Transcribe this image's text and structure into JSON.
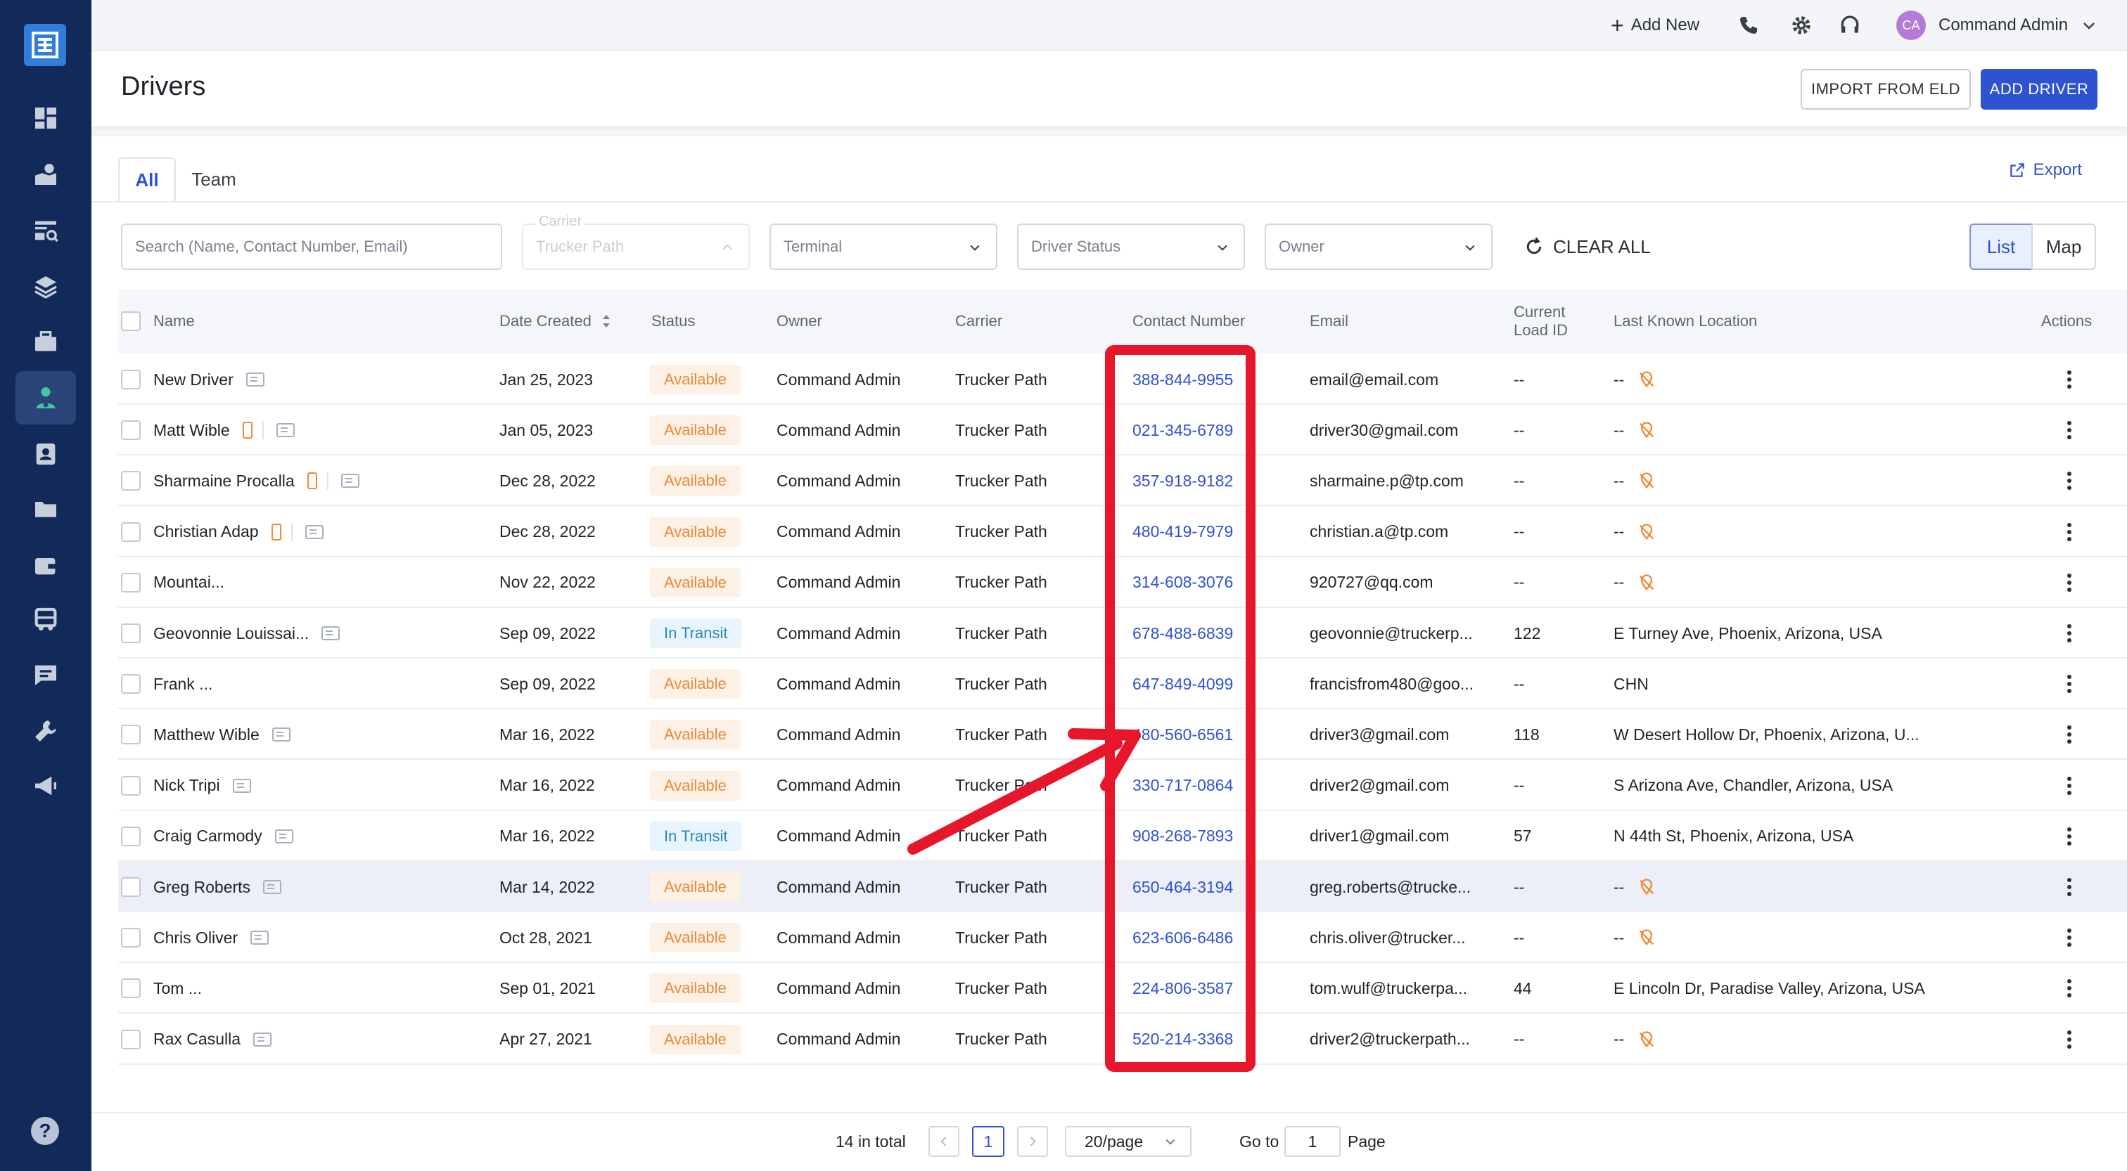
{
  "sidebar": {
    "items": [
      {
        "icon": "dashboard-icon"
      },
      {
        "icon": "tracking-icon"
      },
      {
        "icon": "loadboard-icon"
      },
      {
        "icon": "layers-icon"
      },
      {
        "icon": "briefcase-icon"
      },
      {
        "icon": "drivers-icon",
        "active": true
      },
      {
        "icon": "contacts-icon"
      },
      {
        "icon": "folder-icon"
      },
      {
        "icon": "wallet-icon"
      },
      {
        "icon": "truck-icon"
      },
      {
        "icon": "message-icon"
      },
      {
        "icon": "tools-icon"
      },
      {
        "icon": "megaphone-icon"
      }
    ],
    "help_label": "?"
  },
  "topbar": {
    "add_new": "Add New",
    "avatar_initials": "CA",
    "user_name": "Command Admin"
  },
  "header": {
    "title": "Drivers",
    "import_label": "IMPORT FROM ELD",
    "add_label": "ADD DRIVER"
  },
  "tabs": [
    {
      "label": "All"
    },
    {
      "label": "Team"
    }
  ],
  "export_label": "Export",
  "filters": {
    "search_placeholder": "Search (Name, Contact Number, Email)",
    "carrier_label": "Carrier",
    "carrier_value": "Trucker Path",
    "terminal": "Terminal",
    "driver_status": "Driver Status",
    "owner": "Owner",
    "clear_all": "CLEAR ALL",
    "view_list": "List",
    "view_map": "Map"
  },
  "columns": {
    "name": "Name",
    "date_created": "Date Created",
    "status": "Status",
    "owner": "Owner",
    "carrier": "Carrier",
    "contact": "Contact Number",
    "email": "Email",
    "load_line1": "Current",
    "load_line2": "Load ID",
    "location": "Last Known Location",
    "actions": "Actions"
  },
  "colors": {
    "available_bg": "#fdf0e4",
    "available_fg": "#ea8a3b",
    "transit_bg": "#e7f4fb",
    "transit_fg": "#2f86b8",
    "annotation": "#e8162b"
  },
  "rows": [
    {
      "name": "New Driver",
      "phone_icon": false,
      "date": "Jan 25, 2023",
      "status": "Available",
      "owner": "Command Admin",
      "carrier": "Trucker Path",
      "contact": "388-844-9955",
      "email": "email@email.com",
      "load": "--",
      "location": "--",
      "no_loc_icon": true
    },
    {
      "name": "Matt Wible",
      "phone_icon": true,
      "date": "Jan 05, 2023",
      "status": "Available",
      "owner": "Command Admin",
      "carrier": "Trucker Path",
      "contact": "021-345-6789",
      "email": "driver30@gmail.com",
      "load": "--",
      "location": "--",
      "no_loc_icon": true
    },
    {
      "name": "Sharmaine Procalla",
      "phone_icon": true,
      "date": "Dec 28, 2022",
      "status": "Available",
      "owner": "Command Admin",
      "carrier": "Trucker Path",
      "contact": "357-918-9182",
      "email": "sharmaine.p@tp.com",
      "load": "--",
      "location": "--",
      "no_loc_icon": true
    },
    {
      "name": "Christian Adap",
      "phone_icon": true,
      "date": "Dec 28, 2022",
      "status": "Available",
      "owner": "Command Admin",
      "carrier": "Trucker Path",
      "contact": "480-419-7979",
      "email": "christian.a@tp.com",
      "load": "--",
      "location": "--",
      "no_loc_icon": true
    },
    {
      "name": "Mountai...",
      "phone_icon": false,
      "no_card": true,
      "date": "Nov 22, 2022",
      "status": "Available",
      "owner": "Command Admin",
      "carrier": "Trucker Path",
      "contact": "314-608-3076",
      "email": "920727@qq.com",
      "load": "--",
      "location": "--",
      "no_loc_icon": true
    },
    {
      "name": "Geovonnie Louissai...",
      "phone_icon": false,
      "date": "Sep 09, 2022",
      "status": "In Transit",
      "owner": "Command Admin",
      "carrier": "Trucker Path",
      "contact": "678-488-6839",
      "email": "geovonnie@truckerp...",
      "load": "122",
      "location": "E Turney Ave, Phoenix, Arizona, USA",
      "no_loc_icon": false
    },
    {
      "name": "Frank ...",
      "phone_icon": false,
      "no_card": true,
      "date": "Sep 09, 2022",
      "status": "Available",
      "owner": "Command Admin",
      "carrier": "Trucker Path",
      "contact": "647-849-4099",
      "email": "francisfrom480@goo...",
      "load": "--",
      "location": "CHN",
      "no_loc_icon": false
    },
    {
      "name": "Matthew Wible",
      "phone_icon": false,
      "date": "Mar 16, 2022",
      "status": "Available",
      "owner": "Command Admin",
      "carrier": "Trucker Path",
      "contact": "480-560-6561",
      "email": "driver3@gmail.com",
      "load": "118",
      "location": "W Desert Hollow Dr, Phoenix, Arizona, U...",
      "no_loc_icon": false
    },
    {
      "name": "Nick Tripi",
      "phone_icon": false,
      "date": "Mar 16, 2022",
      "status": "Available",
      "owner": "Command Admin",
      "carrier": "Trucker Path",
      "contact": "330-717-0864",
      "email": "driver2@gmail.com",
      "load": "--",
      "location": "S Arizona Ave, Chandler, Arizona, USA",
      "no_loc_icon": false
    },
    {
      "name": "Craig Carmody",
      "phone_icon": false,
      "date": "Mar 16, 2022",
      "status": "In Transit",
      "owner": "Command Admin",
      "carrier": "Trucker Path",
      "contact": "908-268-7893",
      "email": "driver1@gmail.com",
      "load": "57",
      "location": "N 44th St, Phoenix, Arizona, USA",
      "no_loc_icon": false
    },
    {
      "name": "Greg Roberts",
      "phone_icon": false,
      "date": "Mar 14, 2022",
      "status": "Available",
      "owner": "Command Admin",
      "carrier": "Trucker Path",
      "contact": "650-464-3194",
      "email": "greg.roberts@trucke...",
      "load": "--",
      "location": "--",
      "no_loc_icon": true,
      "highlight": true
    },
    {
      "name": "Chris Oliver",
      "phone_icon": false,
      "date": "Oct 28, 2021",
      "status": "Available",
      "owner": "Command Admin",
      "carrier": "Trucker Path",
      "contact": "623-606-6486",
      "email": "chris.oliver@trucker...",
      "load": "--",
      "location": "--",
      "no_loc_icon": true
    },
    {
      "name": "Tom ...",
      "phone_icon": false,
      "no_card": true,
      "date": "Sep 01, 2021",
      "status": "Available",
      "owner": "Command Admin",
      "carrier": "Trucker Path",
      "contact": "224-806-3587",
      "email": "tom.wulf@truckerpa...",
      "load": "44",
      "location": "E Lincoln Dr, Paradise Valley, Arizona, USA",
      "no_loc_icon": false
    },
    {
      "name": "Rax Casulla",
      "phone_icon": false,
      "date": "Apr 27, 2021",
      "status": "Available",
      "owner": "Command Admin",
      "carrier": "Trucker Path",
      "contact": "520-214-3368",
      "email": "driver2@truckerpath...",
      "load": "--",
      "location": "--",
      "no_loc_icon": true
    }
  ],
  "pagination": {
    "total": "14 in total",
    "current_page": "1",
    "page_size": "20/page",
    "goto_label": "Go to",
    "goto_value": "1",
    "page_label": "Page"
  }
}
